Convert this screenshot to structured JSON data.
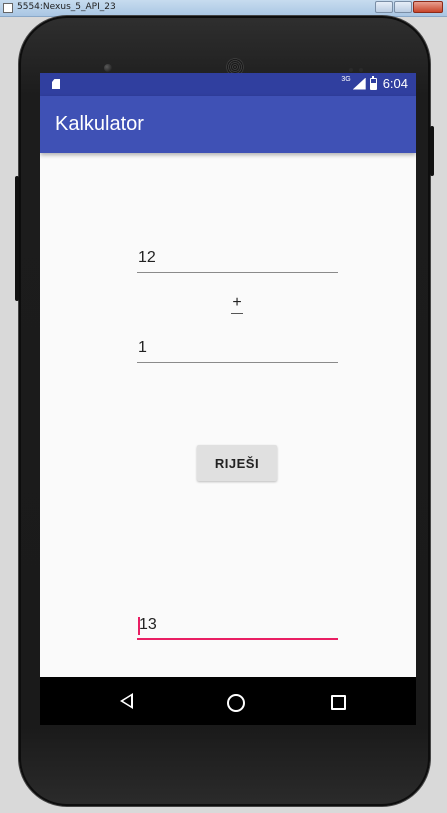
{
  "window": {
    "title": "5554:Nexus_5_API_23"
  },
  "status_bar": {
    "network_type": "3G",
    "time": "6:04",
    "icons": [
      "sd-card-icon",
      "signal-icon",
      "battery-icon"
    ]
  },
  "app_bar": {
    "title": "Kalkulator"
  },
  "form": {
    "first_number": "12",
    "operator": "+",
    "second_number": "1",
    "solve_label": "RIJEŠI",
    "result": "13"
  },
  "nav_bar": {
    "icons": [
      "back-icon",
      "home-icon",
      "recents-icon"
    ]
  },
  "colors": {
    "primary": "#3f51b5",
    "primary_dark": "#303f9f",
    "accent": "#e91e63",
    "screen_background": "#fafafa",
    "button_background": "#e0e0e0"
  }
}
